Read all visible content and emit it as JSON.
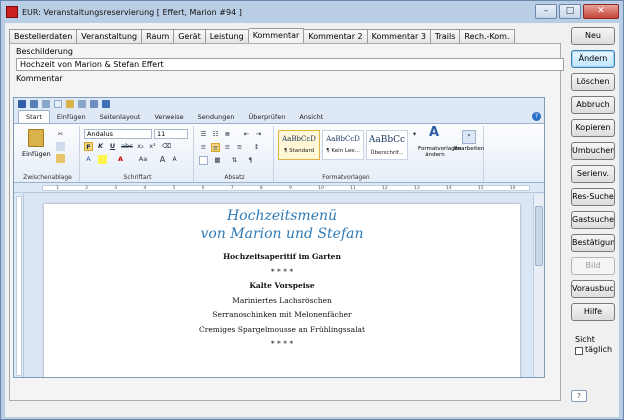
{
  "window": {
    "title": "EUR: Veranstaltungsreservierung [ Effert, Marion #94 ]",
    "controls": {
      "minimize": "–",
      "maximize": "□",
      "close": "✕"
    }
  },
  "tabs": [
    "Bestellerdaten",
    "Veranstaltung",
    "Raum",
    "Gerät",
    "Leistung",
    "Kommentar",
    "Kommentar 2",
    "Kommentar 3",
    "Trails",
    "Rech.-Kom."
  ],
  "active_tab": "Kommentar",
  "form": {
    "beschilderung_label": "Beschilderung",
    "beschilderung_value": "Hochzeit von Marion & Stefan Effert",
    "kommentar_label": "Kommentar"
  },
  "word": {
    "ribbon_tabs": [
      "Start",
      "Einfügen",
      "Seitenlayout",
      "Verweise",
      "Sendungen",
      "Überprüfen",
      "Ansicht"
    ],
    "active_ribbon_tab": "Start",
    "clipboard": {
      "paste": "Einfügen",
      "group": "Zwischenablage"
    },
    "font": {
      "name": "Andalus",
      "size": "11",
      "group": "Schriftart",
      "bold": "F",
      "italic": "K",
      "underline": "U",
      "strike": "abc",
      "sub": "x₂",
      "sup": "x²",
      "grow": "A",
      "shrink": "A",
      "case": "Aa"
    },
    "paragraph": {
      "group": "Absatz",
      "pilcrow": "¶"
    },
    "styles": {
      "group": "Formatvorlagen",
      "items": [
        {
          "sample": "AaBbCcD",
          "name": "¶ Standard"
        },
        {
          "sample": "AaBbCcD",
          "name": "¶ Kein Lee..."
        },
        {
          "sample": "AaBbCc",
          "name": "Überschrif..."
        }
      ],
      "change": "Formatvorlagen ändern",
      "edit": "Bearbeiten"
    },
    "document": {
      "script_line1": "Hochzeitsmenü",
      "script_line2": "von Marion und Stefan",
      "lines": [
        {
          "text": "Hochzeitsaperitif im Garten",
          "bold": true
        },
        {
          "text": "* * * *",
          "bold": false
        },
        {
          "text": "Kalte Vorspeise",
          "bold": true
        },
        {
          "text": "Mariniertes Lachsröschen",
          "bold": false
        },
        {
          "text": "Serranoschinken mit Melonenfächer",
          "bold": false
        },
        {
          "text": "Cremiges Spargelmousse an Frühlingssalat",
          "bold": false
        },
        {
          "text": "* * * *",
          "bold": false
        }
      ]
    }
  },
  "buttons": [
    {
      "label": "Neu",
      "state": "normal"
    },
    {
      "label": "Ändern",
      "state": "default"
    },
    {
      "label": "Löschen",
      "state": "normal"
    },
    {
      "label": "Abbruch",
      "state": "normal"
    },
    {
      "label": "Kopieren",
      "state": "normal"
    },
    {
      "label": "Umbuchen",
      "state": "normal"
    },
    {
      "label": "Serienv.",
      "state": "normal"
    },
    {
      "label": "Res-Suche",
      "state": "normal"
    },
    {
      "label": "Gastsuche",
      "state": "normal"
    },
    {
      "label": "Bestätigung",
      "state": "normal"
    },
    {
      "label": "Bild",
      "state": "disabled"
    },
    {
      "label": "Vorausbuchen",
      "state": "normal"
    },
    {
      "label": "Hilfe",
      "state": "normal"
    }
  ],
  "sicht": {
    "label": "Sicht",
    "checkbox_label": "täglich",
    "checked": false
  },
  "help_icon": "?"
}
